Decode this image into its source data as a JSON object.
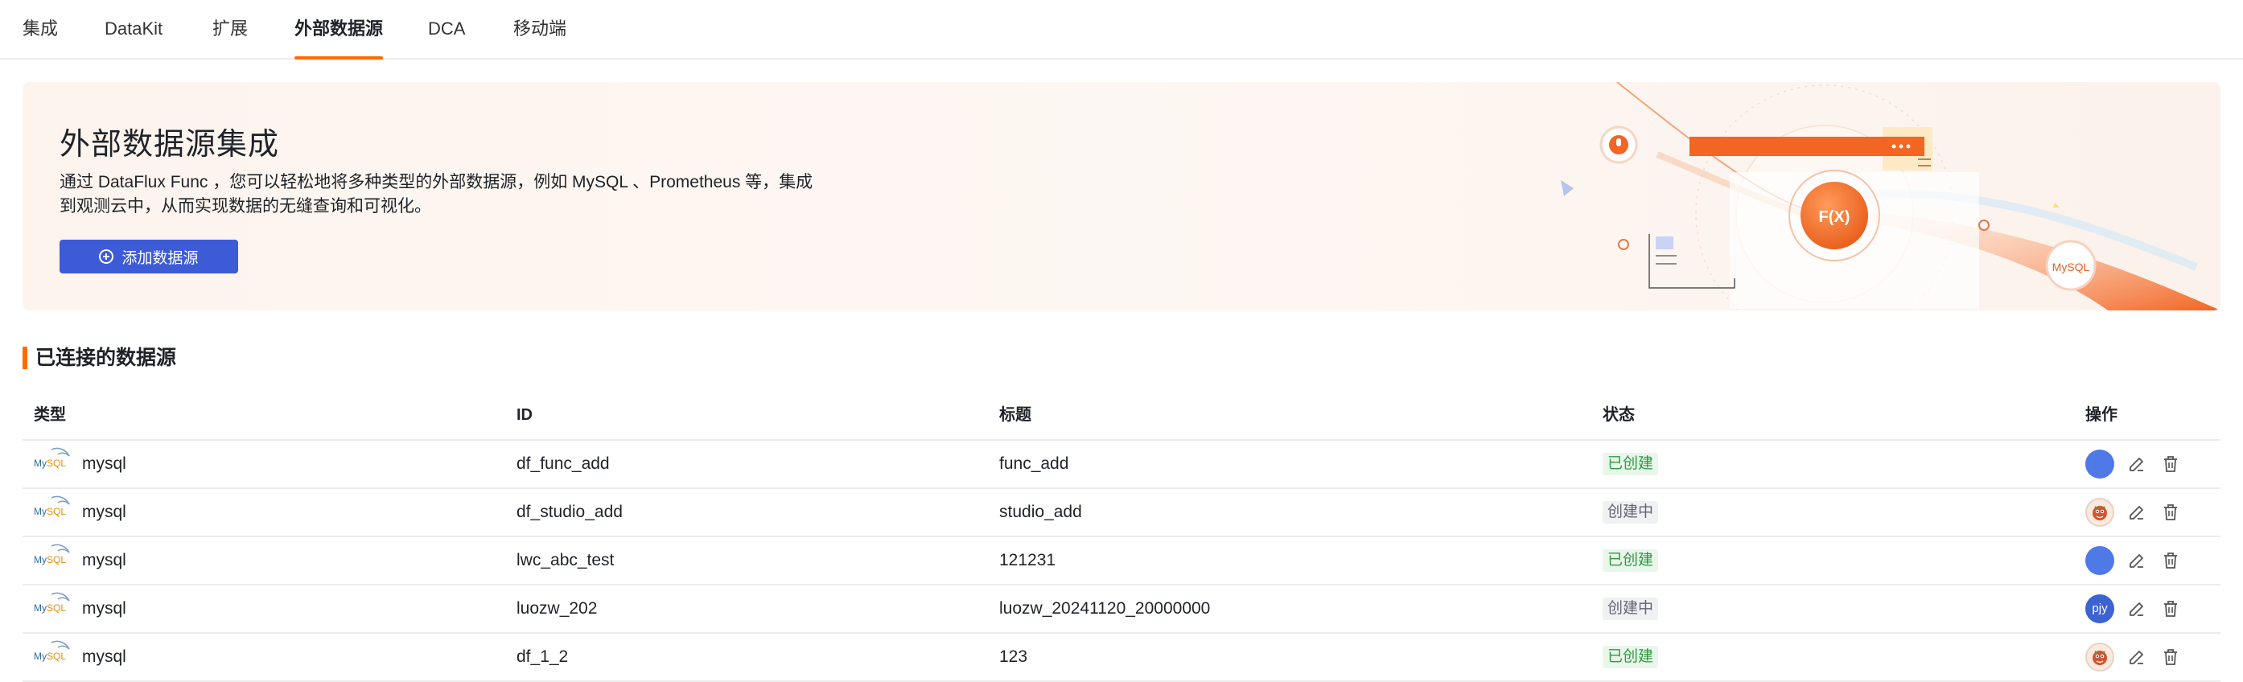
{
  "tabs": [
    {
      "label": "集成",
      "active": false
    },
    {
      "label": "DataKit",
      "active": false
    },
    {
      "label": "扩展",
      "active": false
    },
    {
      "label": "外部数据源",
      "active": true
    },
    {
      "label": "DCA",
      "active": false
    },
    {
      "label": "移动端",
      "active": false
    }
  ],
  "banner": {
    "title": "外部数据源集成",
    "desc_line1": "通过 DataFlux Func ，您可以轻松地将多种类型的外部数据源，例如 MySQL 、Prometheus 等，集成",
    "desc_line2": "到观测云中，从而实现数据的无缝查询和可视化。",
    "add_button": "添加数据源",
    "illus_func": "F(X)",
    "illus_mysql": "MySQL"
  },
  "section": {
    "title": "已连接的数据源"
  },
  "table": {
    "headers": {
      "type": "类型",
      "id": "ID",
      "title": "标题",
      "status": "状态",
      "ops": "操作"
    },
    "rows": [
      {
        "type": "mysql",
        "id": "df_func_add",
        "title": "func_add",
        "status": "已创建",
        "status_kind": "ok",
        "avatar": "blue",
        "avatar_text": ""
      },
      {
        "type": "mysql",
        "id": "df_studio_add",
        "title": "studio_add",
        "status": "创建中",
        "status_kind": "pending",
        "avatar": "mascot",
        "avatar_text": ""
      },
      {
        "type": "mysql",
        "id": "lwc_abc_test",
        "title": "121231",
        "status": "已创建",
        "status_kind": "ok",
        "avatar": "blue",
        "avatar_text": ""
      },
      {
        "type": "mysql",
        "id": "luozw_202",
        "title": "luozw_20241120_20000000",
        "status": "创建中",
        "status_kind": "pending",
        "avatar": "pjy",
        "avatar_text": "pjy"
      },
      {
        "type": "mysql",
        "id": "df_1_2",
        "title": "123",
        "status": "已创建",
        "status_kind": "ok",
        "avatar": "mascot",
        "avatar_text": ""
      }
    ]
  },
  "colors": {
    "accent": "#ff6a00",
    "primary": "#3d5bd6",
    "success": "#2e9a41"
  },
  "icons": {
    "edit": "edit-icon",
    "delete": "trash-icon",
    "add": "plus-circle-icon"
  }
}
